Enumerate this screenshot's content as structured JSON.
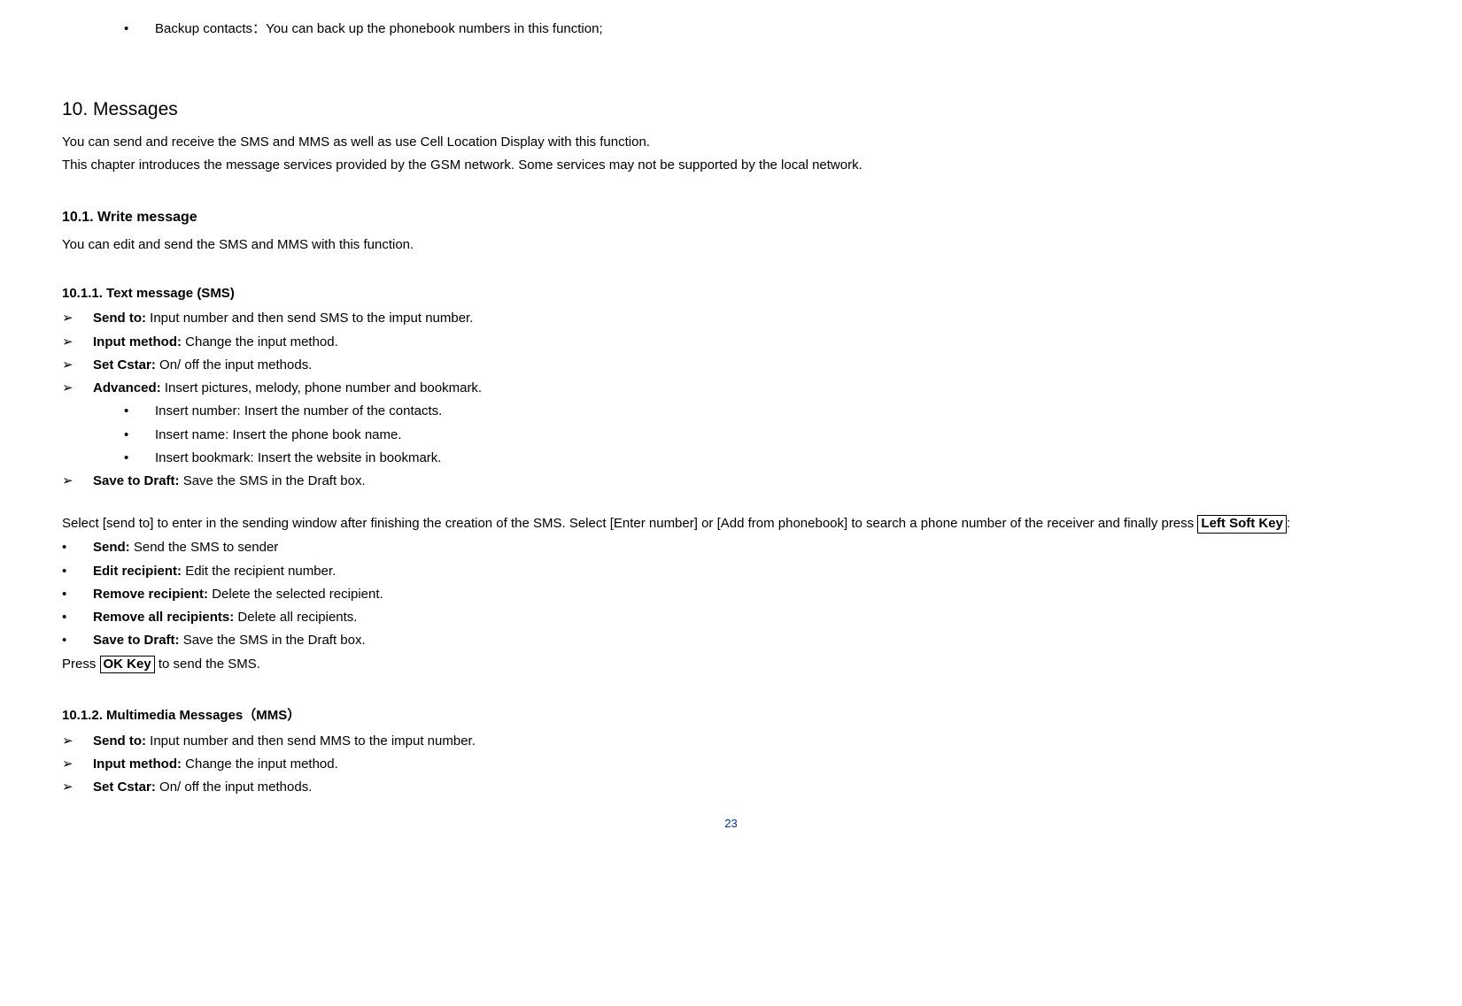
{
  "top_bullet": {
    "label_bold": "Backup contacts：",
    "text": "You can back up the phonebook numbers in this function;"
  },
  "section": {
    "num": "10.",
    "title": "Messages",
    "intro1": "You can send and receive the SMS and MMS as well as use Cell Location Display with this function.",
    "intro2": "This chapter introduces the message services provided by the GSM network. Some services may not be supported by the local network."
  },
  "sub101": {
    "heading": "10.1.   Write message",
    "intro": "You can edit and send the SMS and MMS with this function."
  },
  "sms": {
    "heading": "10.1.1. Text message (SMS)",
    "items": [
      {
        "bold": "Send to: ",
        "rest": "Input number and then send SMS to the imput number."
      },
      {
        "bold": "Input method: ",
        "rest": "Change the input method."
      },
      {
        "bold": "Set Cstar: ",
        "rest": "On/ off the input methods."
      },
      {
        "bold": "Advanced: ",
        "rest": "Insert pictures, melody, phone number and bookmark."
      }
    ],
    "adv_sub": [
      "Insert number: Insert the number of the contacts.",
      "Insert name: Insert the phone book name.",
      "Insert bookmark: Insert the website in bookmark."
    ],
    "save_draft": {
      "bold": "Save to Draft: ",
      "rest": "Save the SMS in the Draft box."
    }
  },
  "send_para": {
    "before_key": "Select [send to] to enter in the sending window after finishing the creation of the SMS. Select [Enter number] or [Add from phonebook] to search a phone number of the receiver and finally press ",
    "key": "Left Soft Key",
    "after_key": ":"
  },
  "send_list": [
    {
      "bold": "Send: ",
      "rest": "Send the SMS to sender"
    },
    {
      "bold": "Edit recipient: ",
      "rest": "Edit the recipient number."
    },
    {
      "bold": "Remove recipient: ",
      "rest": "Delete the selected recipient."
    },
    {
      "bold": "Remove all recipients: ",
      "rest": "Delete all recipients."
    },
    {
      "bold": "Save to Draft: ",
      "rest": "Save the SMS in the Draft box."
    }
  ],
  "press_line": {
    "before": "Press ",
    "key": "OK Key",
    "after": " to send the SMS."
  },
  "mms": {
    "heading": "10.1.2. Multimedia Messages（MMS）",
    "items": [
      {
        "bold": "Send to: ",
        "rest": "Input number and then send MMS to the imput number."
      },
      {
        "bold": "Input method: ",
        "rest": "Change the input method."
      },
      {
        "bold": "Set Cstar: ",
        "rest": "On/ off the input methods."
      }
    ]
  },
  "page_number": "23",
  "glyphs": {
    "dot": "•",
    "chev": "➢"
  }
}
